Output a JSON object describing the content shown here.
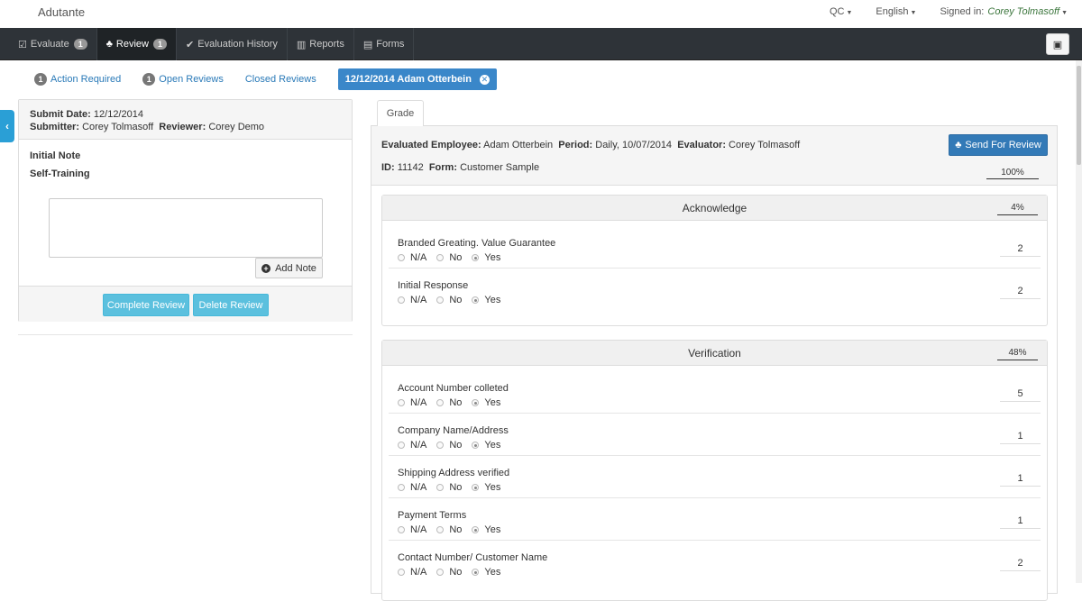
{
  "app": {
    "brand": "Adutante"
  },
  "topnav": {
    "qc": "QC",
    "language": "English",
    "signed_in_label": "Signed in:",
    "user": "Corey Tolmasoff"
  },
  "nav": {
    "tabs": [
      {
        "label": "Evaluate",
        "badge": "1",
        "icon": "clipboard-check-icon"
      },
      {
        "label": "Review",
        "badge": "1",
        "icon": "users-icon"
      },
      {
        "label": "Evaluation History",
        "icon": "checkmark-icon"
      },
      {
        "label": "Reports",
        "icon": "bar-chart-icon"
      },
      {
        "label": "Forms",
        "icon": "comments-icon"
      }
    ]
  },
  "subtabs": {
    "action_required": {
      "count": "1",
      "label": "Action Required"
    },
    "open_reviews": {
      "count": "1",
      "label": "Open Reviews"
    },
    "closed_reviews": {
      "label": "Closed Reviews"
    },
    "active": {
      "label": "12/12/2014 Adam Otterbein"
    }
  },
  "review": {
    "submit_date_label": "Submit Date:",
    "submit_date": "12/12/2014",
    "submitter_label": "Submitter:",
    "submitter": "Corey Tolmasoff",
    "reviewer_label": "Reviewer:",
    "reviewer": "Corey Demo",
    "initial_note": "Initial Note",
    "self_training": "Self-Training",
    "note_value": "",
    "add_note": "Add Note",
    "complete_review": "Complete Review",
    "delete_review": "Delete Review"
  },
  "grade": {
    "tab_label": "Grade",
    "evaluated_employee_label": "Evaluated Employee:",
    "evaluated_employee": "Adam Otterbein",
    "period_label": "Period:",
    "period": "Daily, 10/07/2014",
    "evaluator_label": "Evaluator:",
    "evaluator": "Corey Tolmasoff",
    "id_label": "ID:",
    "id": "11142",
    "form_label": "Form:",
    "form": "Customer Sample",
    "total_pct": "100%",
    "send_for_review": "Send For Review"
  },
  "options": {
    "na": "N/A",
    "no": "No",
    "yes": "Yes"
  },
  "sections": [
    {
      "title": "Acknowledge",
      "pct": "4%",
      "questions": [
        {
          "title": "Branded Greating. Value Guarantee",
          "selected": "yes",
          "score": "2"
        },
        {
          "title": "Initial Response",
          "selected": "yes",
          "score": "2"
        }
      ]
    },
    {
      "title": "Verification",
      "pct": "48%",
      "questions": [
        {
          "title": "Account Number colleted",
          "selected": "yes",
          "score": "5"
        },
        {
          "title": "Company Name/Address",
          "selected": "yes",
          "score": "1"
        },
        {
          "title": "Shipping Address verified",
          "selected": "yes",
          "score": "1"
        },
        {
          "title": "Payment Terms",
          "selected": "yes",
          "score": "1"
        },
        {
          "title": "Contact Number/ Customer Name",
          "selected": "yes",
          "score": "2"
        }
      ]
    }
  ]
}
